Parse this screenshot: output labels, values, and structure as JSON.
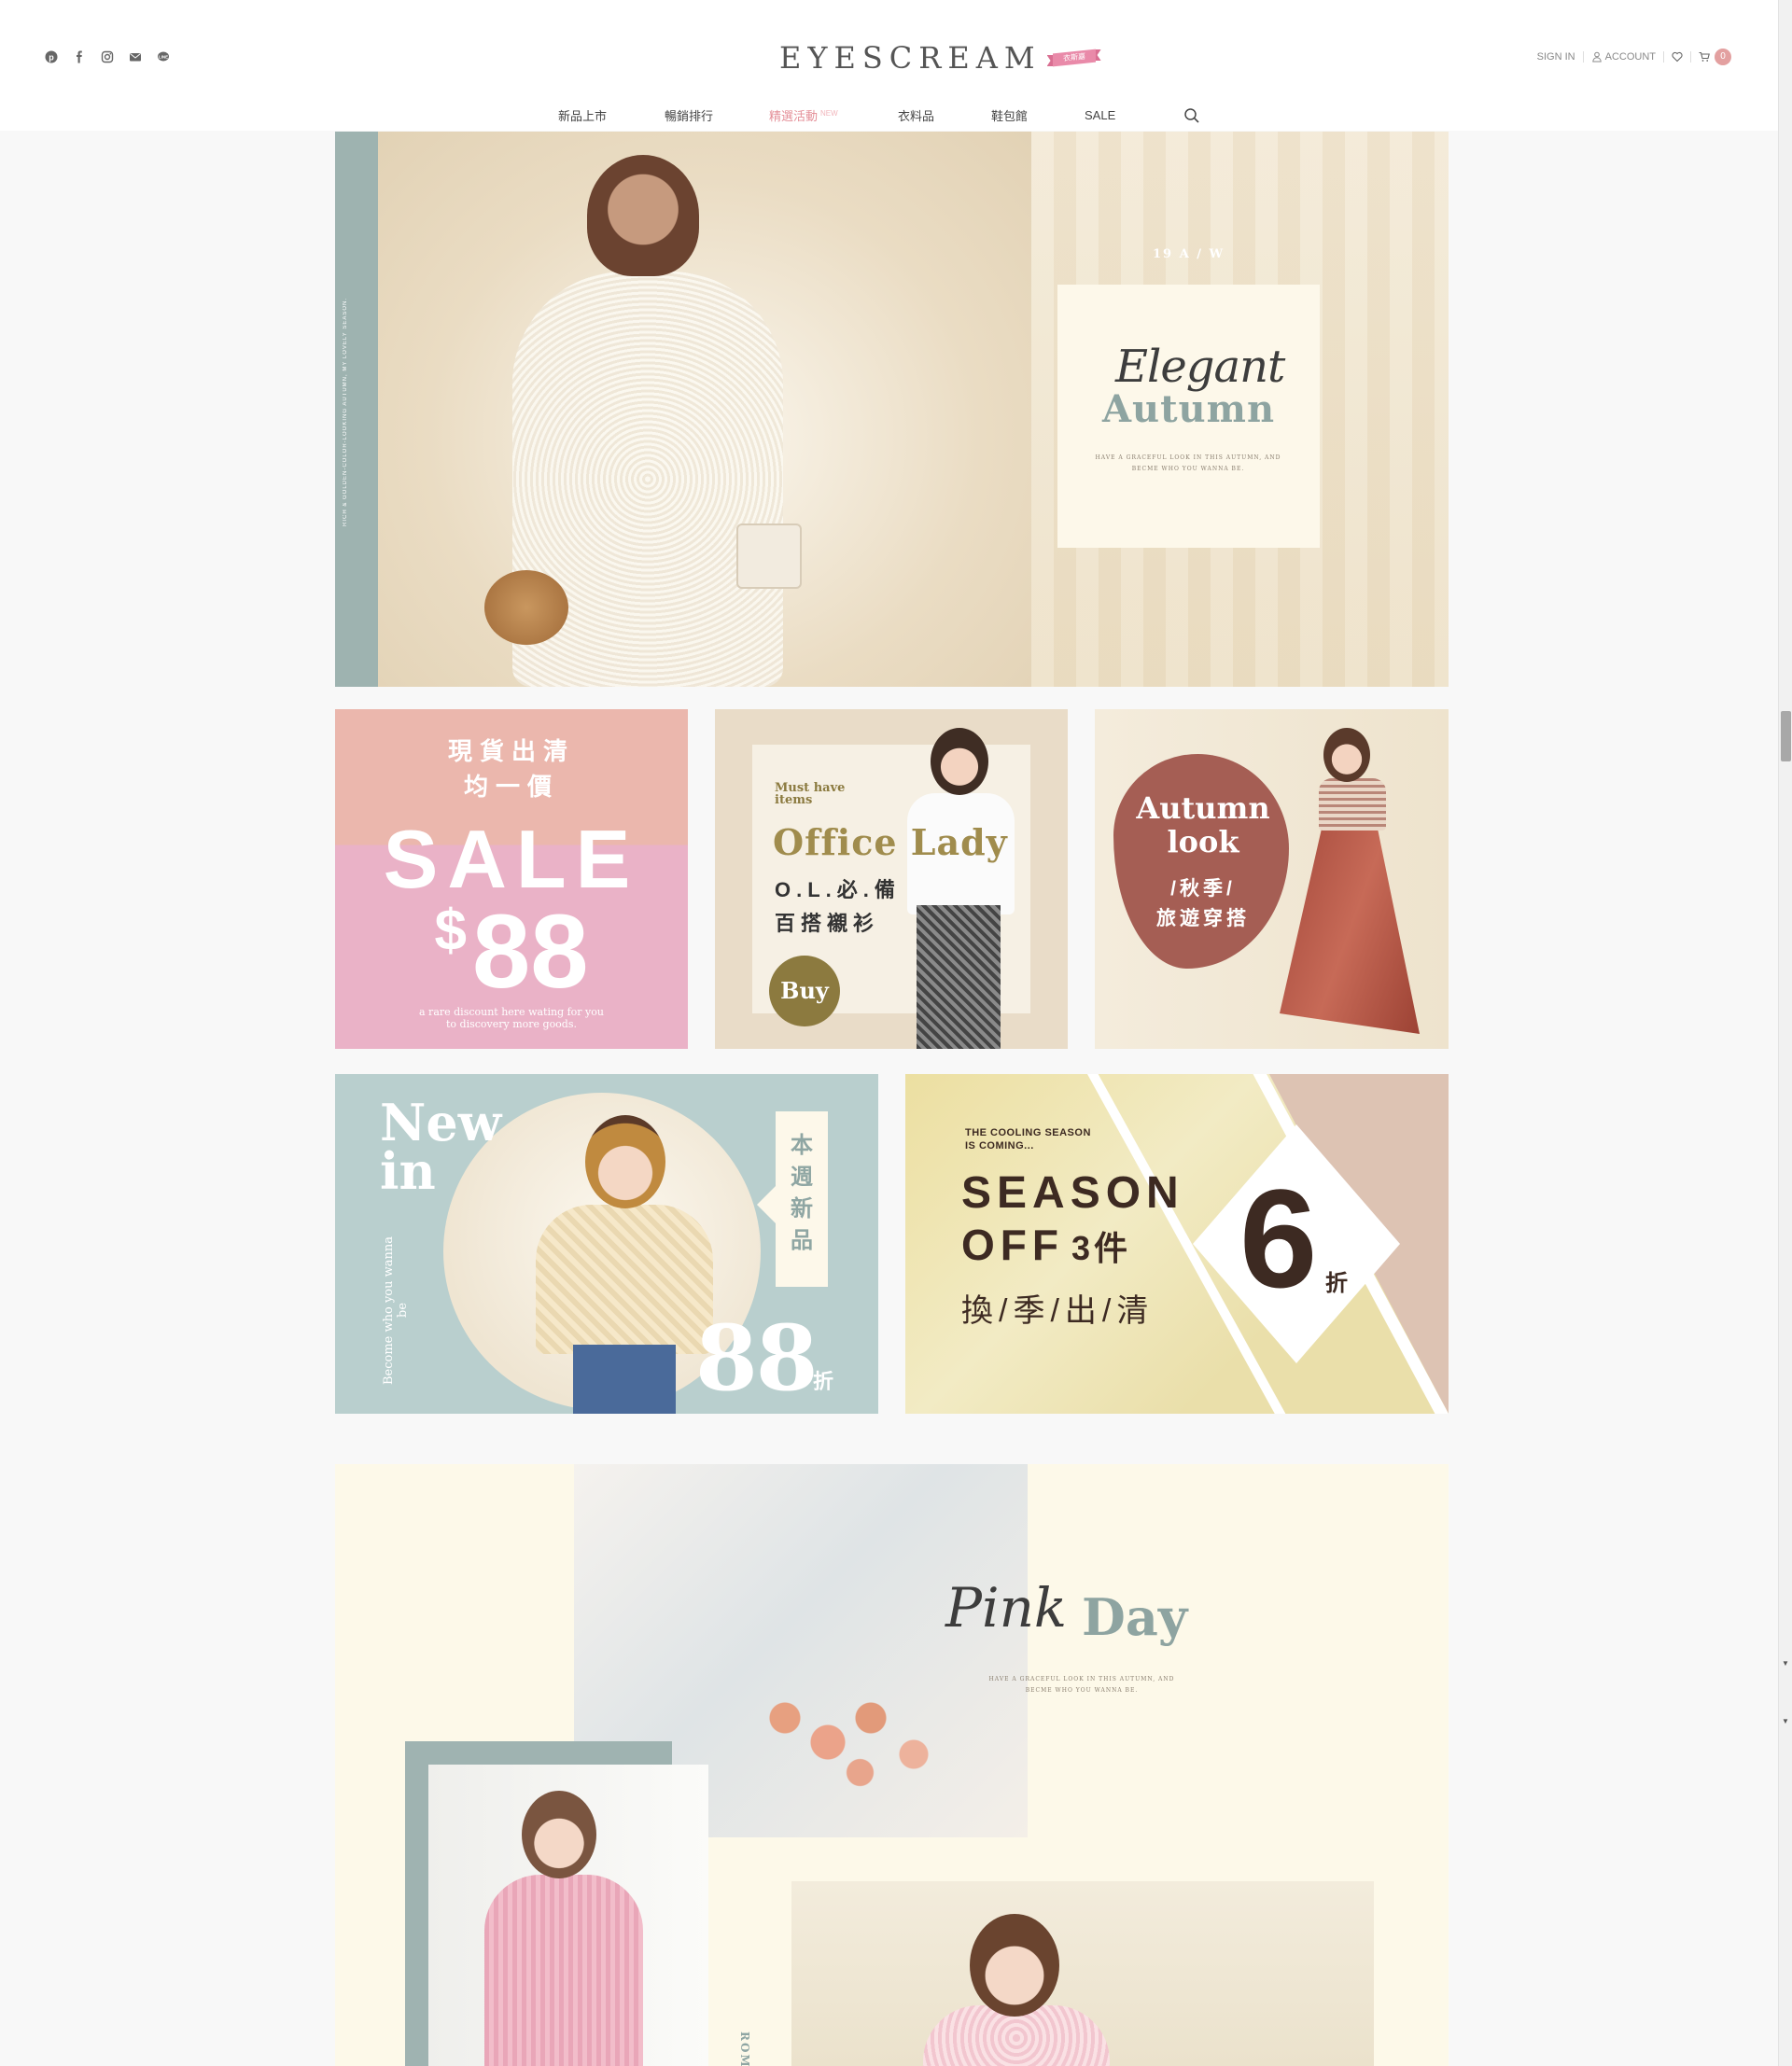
{
  "header": {
    "logo": "EYESCREAM",
    "logo_ribbon": "衣斯嘉",
    "social": [
      "pixnet-icon",
      "facebook-icon",
      "instagram-icon",
      "mail-icon",
      "line-icon"
    ],
    "user_nav": {
      "sign_in": "SIGN IN",
      "account": "ACCOUNT",
      "cart_count": "0"
    },
    "main_nav": [
      {
        "label": "新品上市"
      },
      {
        "label": "暢銷排行"
      },
      {
        "label": "精選活動",
        "tag": "NEW"
      },
      {
        "label": "衣料品"
      },
      {
        "label": "鞋包館"
      },
      {
        "label": "SALE"
      }
    ]
  },
  "hero": {
    "side_text": "RICH & GOLDEN-COLOR-LOOKING AUTUMN, MY LOVELY SEASON.",
    "season": "19 A / W",
    "script": "Elegant",
    "title": "Autumn",
    "subtitle": "HAVE A GRACEFUL LOOK IN THIS AUTUMN, AND BECME WHO YOU WANNA BE."
  },
  "tiles": {
    "sale": {
      "zh_line1": "現貨出清",
      "zh_line2": "均一價",
      "big": "SALE",
      "currency": "$",
      "price": "88",
      "note_line1": "a rare discount here wating for you",
      "note_line2": "to discovery more goods."
    },
    "office": {
      "must_line1": "Must have",
      "must_line2": "items",
      "title": "Office Lady",
      "zh_line1": "O.L.必.備",
      "zh_line2": "百搭襯衫",
      "button": "Buy"
    },
    "autumn": {
      "en_line1": "Autumn",
      "en_line2": "look",
      "zh_line1": "/秋季/",
      "zh_line2": "旅遊穿搭"
    },
    "newin": {
      "en_line1": "New",
      "en_line2": "in",
      "side": "Become who you wanna be",
      "tab": "本週新品",
      "percent": "88",
      "zhe": "折"
    },
    "season": {
      "cool_line1": "THE COOLING SEASON",
      "cool_line2": "IS COMING...",
      "line1": "SEASON",
      "line2": "OFF",
      "line2_small": "3件",
      "line3": "換/季/出/清",
      "discount": "6",
      "zhe": "折"
    }
  },
  "pink_day": {
    "script": "Pink",
    "title": "Day",
    "subtitle": "HAVE A GRACEFUL LOOK IN THIS AUTUMN, AND BECME WHO YOU WANNA BE.",
    "vertical_text": "ROM"
  }
}
